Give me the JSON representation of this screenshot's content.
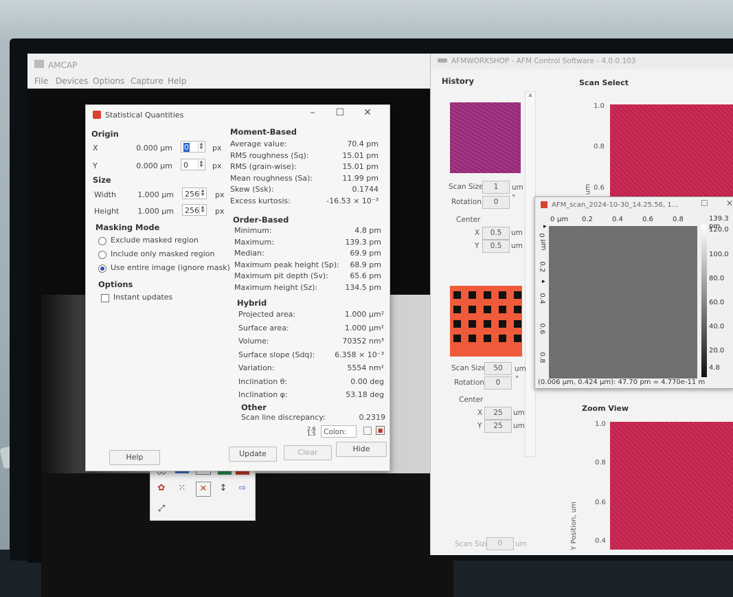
{
  "amcap": {
    "title": "AMCAP",
    "menu": [
      "File",
      "Devices",
      "Options",
      "Capture",
      "Help"
    ]
  },
  "dialog": {
    "title": "Statistical Quantities",
    "origin": {
      "heading": "Origin",
      "x_label": "X",
      "x_value": "0.000 µm",
      "x_px": "0",
      "x_unit": "px",
      "y_label": "Y",
      "y_value": "0.000 µm",
      "y_px": "0",
      "y_unit": "px"
    },
    "size": {
      "heading": "Size",
      "width_label": "Width",
      "width_value": "1.000 µm",
      "width_px": "256",
      "width_unit": "px",
      "height_label": "Height",
      "height_value": "1.000 µm",
      "height_px": "256",
      "height_unit": "px"
    },
    "masking": {
      "heading": "Masking Mode",
      "opt1": "Exclude masked region",
      "opt2": "Include only masked region",
      "opt3": "Use entire image (ignore mask)"
    },
    "options": {
      "heading": "Options",
      "instant": "Instant updates"
    },
    "moment": {
      "heading": "Moment-Based",
      "rows": [
        {
          "label": "Average value:",
          "value": "70.4 pm"
        },
        {
          "label": "RMS roughness (Sq):",
          "value": "15.01 pm"
        },
        {
          "label": "RMS (grain-wise):",
          "value": "15.01 pm"
        },
        {
          "label": "Mean roughness (Sa):",
          "value": "11.99 pm"
        },
        {
          "label": "Skew (Ssk):",
          "value": "0.1744"
        },
        {
          "label": "Excess kurtosis:",
          "value": "-16.53 × 10⁻³"
        }
      ]
    },
    "order": {
      "heading": "Order-Based",
      "rows": [
        {
          "label": "Minimum:",
          "value": "4.8 pm"
        },
        {
          "label": "Maximum:",
          "value": "139.3 pm"
        },
        {
          "label": "Median:",
          "value": "69.9 pm"
        },
        {
          "label": "Maximum peak height (Sp):",
          "value": "68.9 pm"
        },
        {
          "label": "Maximum pit depth (Sv):",
          "value": "65.6 pm"
        },
        {
          "label": "Maximum height (Sz):",
          "value": "134.5 pm"
        }
      ]
    },
    "hybrid": {
      "heading": "Hybrid",
      "rows": [
        {
          "label": "Projected area:",
          "value": "1.000 µm²"
        },
        {
          "label": "Surface area:",
          "value": "1.000 µm²"
        },
        {
          "label": "Volume:",
          "value": "70352 nm³"
        },
        {
          "label": "Surface slope (Sdq):",
          "value": "6.358 × 10⁻³"
        },
        {
          "label": "Variation:",
          "value": "5554 nm²"
        },
        {
          "label": "Inclination θ:",
          "value": "0.00 deg"
        },
        {
          "label": "Inclination φ:",
          "value": "53.18 deg"
        }
      ]
    },
    "other": {
      "heading": "Other",
      "rows": [
        {
          "label": "Scan line discrepancy:",
          "value": "0.2319"
        }
      ]
    },
    "colon_label": "Colon:",
    "buttons": {
      "help": "Help",
      "update": "Update",
      "clear": "Clear",
      "hide": "Hide"
    }
  },
  "afm": {
    "title": "AFMWORKSHOP - AFM Control Software - 4.0.0.103",
    "history": "History",
    "scan_select": "Scan Select",
    "zoom_view": "Zoom View",
    "thumb1": {
      "scan_size_label": "Scan Size",
      "scan_size": "1",
      "scan_unit": "um",
      "rotation_label": "Rotation",
      "rotation": "0",
      "rotation_unit": "°",
      "center_label": "Center",
      "x_label": "X",
      "x": "0.5",
      "x_unit": "um",
      "y_label": "Y",
      "y": "0.5",
      "y_unit": "um"
    },
    "thumb2": {
      "scan_size_label": "Scan Size",
      "scan_size": "50",
      "scan_unit": "um",
      "rotation_label": "Rotation",
      "rotation": "0",
      "rotation_unit": "°",
      "center_label": "Center",
      "x_label": "X",
      "x": "25",
      "x_unit": "um",
      "y_label": "Y",
      "y": "25",
      "y_unit": "um"
    },
    "thumb3": {
      "scan_size_label": "Scan Size",
      "scan_size": "0",
      "scan_unit": "um"
    },
    "scan_select_axis": [
      "1.0",
      "0.8",
      "0.6"
    ],
    "scan_select_unit": "um",
    "zoom_axis": [
      "1.0",
      "0.8",
      "0.6",
      "0.4"
    ],
    "zoom_ylabel": "Y Position, um"
  },
  "scan_window": {
    "title": "AFM_scan_2024-10-30_14.25.56, 1...",
    "top_axis": [
      "0",
      "µm",
      "0.2",
      "0.4",
      "0.6",
      "0.8"
    ],
    "left_axis": [
      "0",
      "µm",
      "0.2",
      "0.4",
      "0.6",
      "0.8"
    ],
    "colorbar": [
      "139.3 pm",
      "120.0",
      "100.0",
      "80.0",
      "60.0",
      "40.0",
      "20.0",
      "4.8"
    ],
    "status": "(0.006 µm, 0.424 µm): 47.70 pm = 4.770e-11 m"
  }
}
